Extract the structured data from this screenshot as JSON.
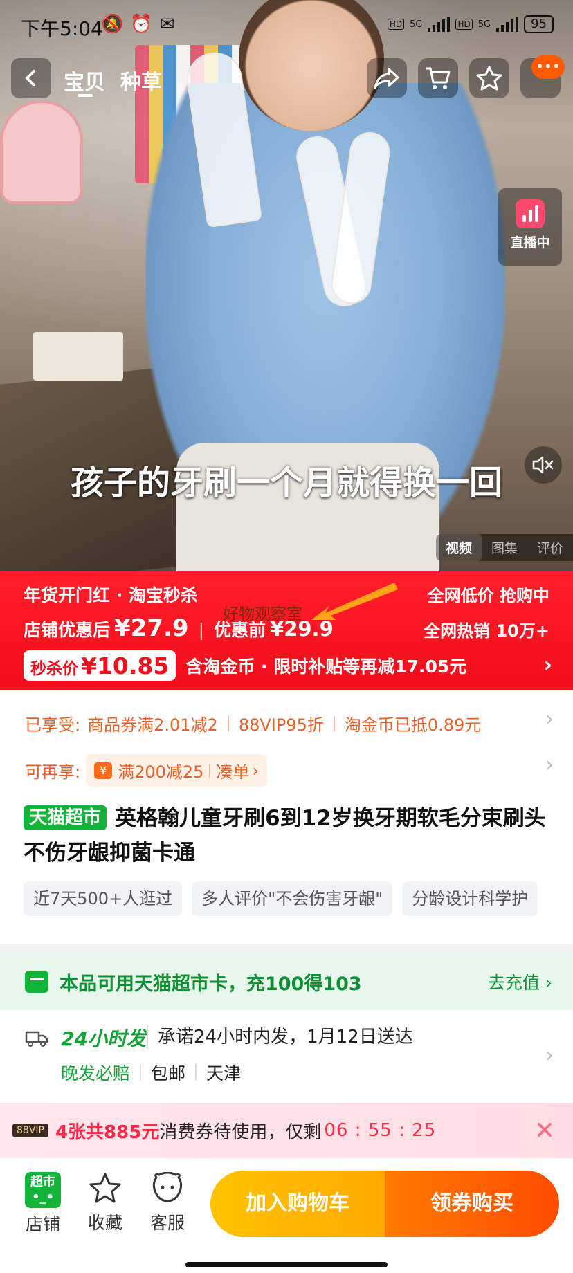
{
  "status_bar": {
    "time": "下午5:04",
    "network_1": "5G",
    "network_2": "5G",
    "hd_1": "HD",
    "hd_2": "HD",
    "battery": "95"
  },
  "nav": {
    "tabs": [
      "宝贝",
      "种草"
    ],
    "share_icon": "share-icon",
    "cart_icon": "cart-icon",
    "favorite_icon": "star-icon",
    "more_icon": "more-icon"
  },
  "video": {
    "live_label": "直播中",
    "subtitle": "孩子的牙刷一个月就得换一回",
    "media_tabs": [
      "视频",
      "图集",
      "评价"
    ],
    "active_media_tab": "视频"
  },
  "promo": {
    "title": "年货开门红 · 淘宝秒杀",
    "shop_discount_label": "店铺优惠后",
    "shop_discount_price": "¥27.9",
    "original_label": "优惠前",
    "original_price": "¥29.9",
    "watermark": "好物观察室",
    "right_line1": "全网低价 抢购中",
    "right_line2": "全网热销 10万+",
    "flash_label": "秒杀价",
    "flash_price": "¥10.85",
    "flash_note": "含淘金币 · 限时补贴等再减17.05元",
    "colors": {
      "bar": "#f10e1a",
      "accent": "#ffffff"
    }
  },
  "benefits": {
    "enjoyed_label": "已享受:",
    "enjoyed_items": [
      "商品券满2.01减2",
      "88VIP95折",
      "淘金币已抵0.89元"
    ],
    "more_label": "可再享:",
    "coupon_text": "满200减25",
    "coupon_action": "凑单"
  },
  "product": {
    "store_badge": "天猫超市",
    "title": "英格翰儿童牙刷6到12岁换牙期软毛分束刷头不伤牙龈抑菌卡通",
    "tags": [
      "近7天500+人逛过",
      "多人评价\"不会伤害牙龈\"",
      "分龄设计科学护"
    ]
  },
  "card_row": {
    "text": "本品可用天猫超市卡，充100得103",
    "action": "去充值"
  },
  "shipping": {
    "badge": "24小时发",
    "promise": "承诺24小时内发，1月12日送达",
    "late_comp": "晚发必赔",
    "free_ship": "包邮",
    "origin": "天津"
  },
  "vip_banner": {
    "badge": "88VIP",
    "count_text": "4张共885元",
    "suffix": "消费券待使用，仅剩",
    "timer": "06 : 55 : 25"
  },
  "bottom_bar": {
    "shop_logo": "超市",
    "shop_label": "店铺",
    "fav_label": "收藏",
    "cs_label": "客服",
    "add_cart": "加入购物车",
    "buy_now": "领券购买",
    "colors": {
      "add_cart": "#ffb300",
      "buy_now": "#ff5a00"
    }
  }
}
